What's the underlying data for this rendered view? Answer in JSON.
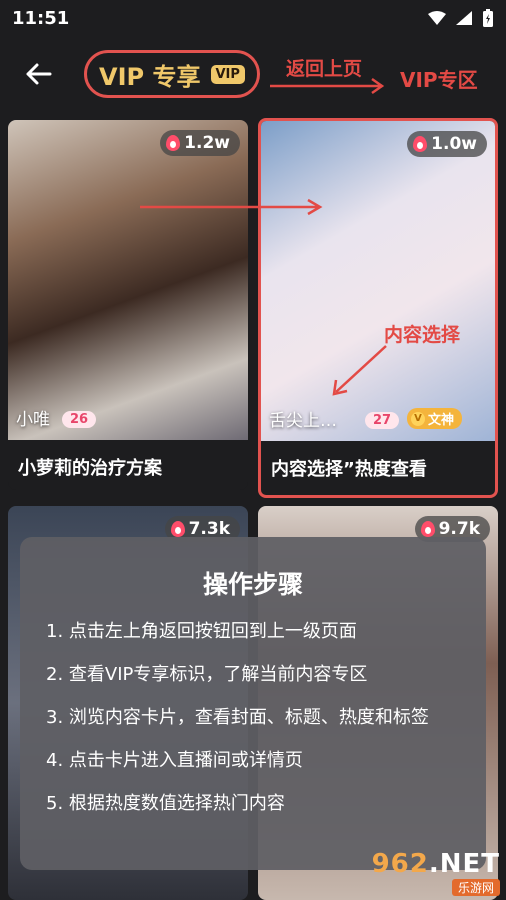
{
  "status": {
    "time": "11:51"
  },
  "header": {
    "vip_label": "VIP 专享",
    "vip_badge": "VIP",
    "annotation_back": "返回上页",
    "annotation_vip": "VIP专区"
  },
  "cards": [
    {
      "hot": "1.2w",
      "name": "小唯",
      "level": "26",
      "title": "小萝莉的治疗方案"
    },
    {
      "hot": "1.0w",
      "name": "舌尖上…",
      "level": "27",
      "badge": "文神",
      "title": "内容选择”热度查看",
      "annotation": "内容选择"
    },
    {
      "hot": "7.3k"
    },
    {
      "hot": "9.7k"
    }
  ],
  "guide": {
    "title": "操作步骤",
    "steps": [
      "1. 点击左上角返回按钮回到上一级页面",
      "2. 查看VIP专享标识，了解当前内容专区",
      "3. 浏览内容卡片，查看封面、标题、热度和标签",
      "4. 点击卡片进入直播间或详情页",
      "5. 根据热度数值选择热门内容"
    ]
  },
  "watermark": {
    "main_a": "962",
    "main_b": ".NET",
    "sub": "乐游网"
  }
}
